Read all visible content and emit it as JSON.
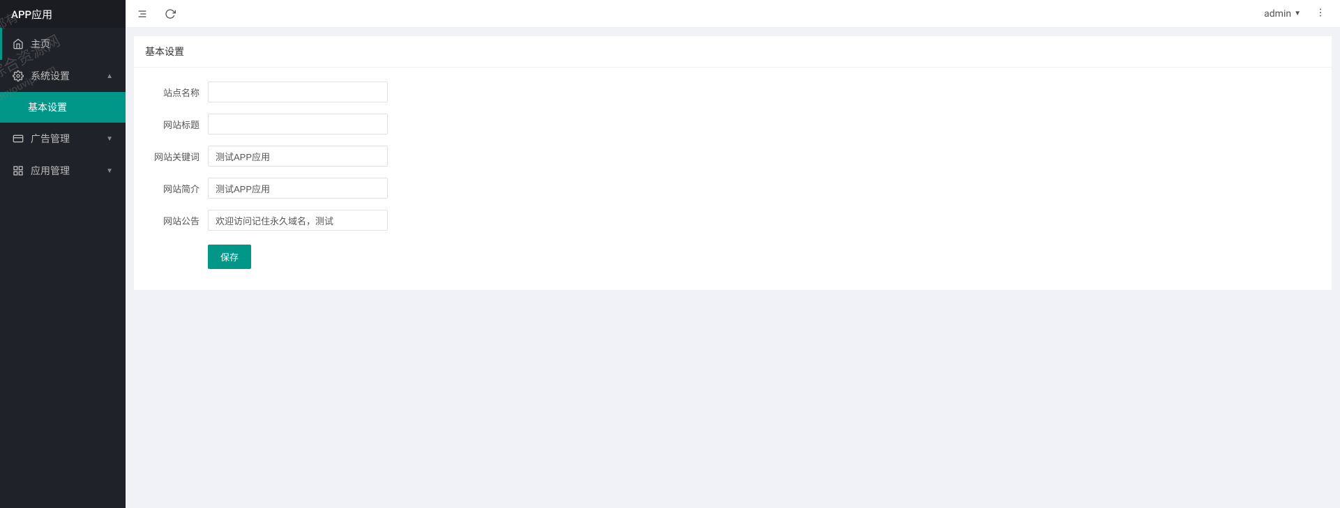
{
  "app_title": "APP应用",
  "watermark": {
    "line1": "都有",
    "line2": "综合资源网",
    "line3": "duyouvip.com"
  },
  "sidebar": {
    "items": [
      {
        "label": "主页",
        "icon": "home"
      },
      {
        "label": "系统设置",
        "icon": "gear",
        "expanded": true,
        "children": [
          {
            "label": "基本设置",
            "active": true
          }
        ]
      },
      {
        "label": "广告管理",
        "icon": "ad",
        "expanded": false
      },
      {
        "label": "应用管理",
        "icon": "apps",
        "expanded": false
      }
    ]
  },
  "header": {
    "user": "admin"
  },
  "panel": {
    "title": "基本设置",
    "fields": {
      "site_name": {
        "label": "站点名称",
        "value": ""
      },
      "site_title": {
        "label": "网站标题",
        "value": ""
      },
      "site_keywords": {
        "label": "网站关键词",
        "value": "测试APP应用"
      },
      "site_desc": {
        "label": "网站简介",
        "value": "测试APP应用"
      },
      "site_notice": {
        "label": "网站公告",
        "value": "欢迎访问记住永久域名，测试"
      }
    },
    "save_label": "保存"
  }
}
